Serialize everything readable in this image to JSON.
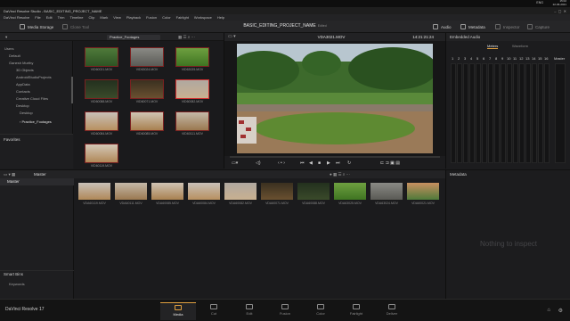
{
  "taskbar": {
    "time": "15:02",
    "date": "22-06-2021",
    "lang": "ENG"
  },
  "titlebar": {
    "title": "DaVinci Resolve Studio - BASIC_EDITING_PROJECT_NAME"
  },
  "menu": [
    "DaVinci Resolve",
    "File",
    "Edit",
    "Trim",
    "Timeline",
    "Clip",
    "Mark",
    "View",
    "Playback",
    "Fusion",
    "Color",
    "Fairlight",
    "Workspace",
    "Help"
  ],
  "toolbar": {
    "media_storage": "Media Storage",
    "clone_tool": "Clone Tool",
    "project_name": "BASIC_EDITING_PROJECT_NAME",
    "project_status": "Edited",
    "audio": "Audio",
    "metadata": "Metadata",
    "inspector": "Inspector",
    "capture": "Capture"
  },
  "media_subbar": {
    "folder": "Practice_Footages"
  },
  "tree": {
    "items": [
      "Users",
      "Default",
      "Ganesh Murthy",
      "3D Objects",
      "AndroidStudioProjects",
      "AppData",
      "Contacts",
      "Creative Cloud Files",
      "Desktop",
      "Desktop",
      "Practice_Footages"
    ],
    "favorites": "Favorites"
  },
  "thumbs": [
    {
      "label": "VID60021.MOV"
    },
    {
      "label": "VID63024.MOV"
    },
    {
      "label": "VID63025.MOV"
    },
    {
      "label": "VID60088.MOV"
    },
    {
      "label": "VID60071.MOV"
    },
    {
      "label": "VID60082.MOV"
    },
    {
      "label": "VID60084.MOV"
    },
    {
      "label": "VID60085.MOV"
    },
    {
      "label": "VID60111.MOV"
    },
    {
      "label": "VID60119.MOV"
    }
  ],
  "viewer": {
    "clip": "VDA3021.MOV",
    "timecode": "14:21:21:24"
  },
  "audio_panel": {
    "title": "Embedded Audio",
    "tab_meters": "Meters",
    "tab_waveform": "Waveform",
    "channels": [
      "1",
      "2",
      "3",
      "4",
      "5",
      "6",
      "7",
      "8",
      "9",
      "10",
      "11",
      "12",
      "13",
      "14",
      "15",
      "16"
    ],
    "master": "Master"
  },
  "master_bar": {
    "label": "Master",
    "bin": "Master",
    "smart_bins": "Smart Bins",
    "keywords": "Keywords"
  },
  "strip": [
    {
      "label": "VDA60119.MOV"
    },
    {
      "label": "VDA60111.MOV"
    },
    {
      "label": "VDA60085.MOV"
    },
    {
      "label": "VDA60084.MOV"
    },
    {
      "label": "VDA60082.MOV"
    },
    {
      "label": "VDA60071.MOV"
    },
    {
      "label": "VDA60088.MOV"
    },
    {
      "label": "VDA63025.MOV"
    },
    {
      "label": "VDA63024.MOV"
    },
    {
      "label": "VDA60021.MOV"
    }
  ],
  "metadata_panel": {
    "title": "Metadata",
    "empty": "Nothing to inspect"
  },
  "pages": [
    "Media",
    "Cut",
    "Edit",
    "Fusion",
    "Color",
    "Fairlight",
    "Deliver"
  ],
  "app_label": "DaVinci Resolve 17",
  "colors": {
    "accent": "#e0a040",
    "selection": "#d03030"
  }
}
